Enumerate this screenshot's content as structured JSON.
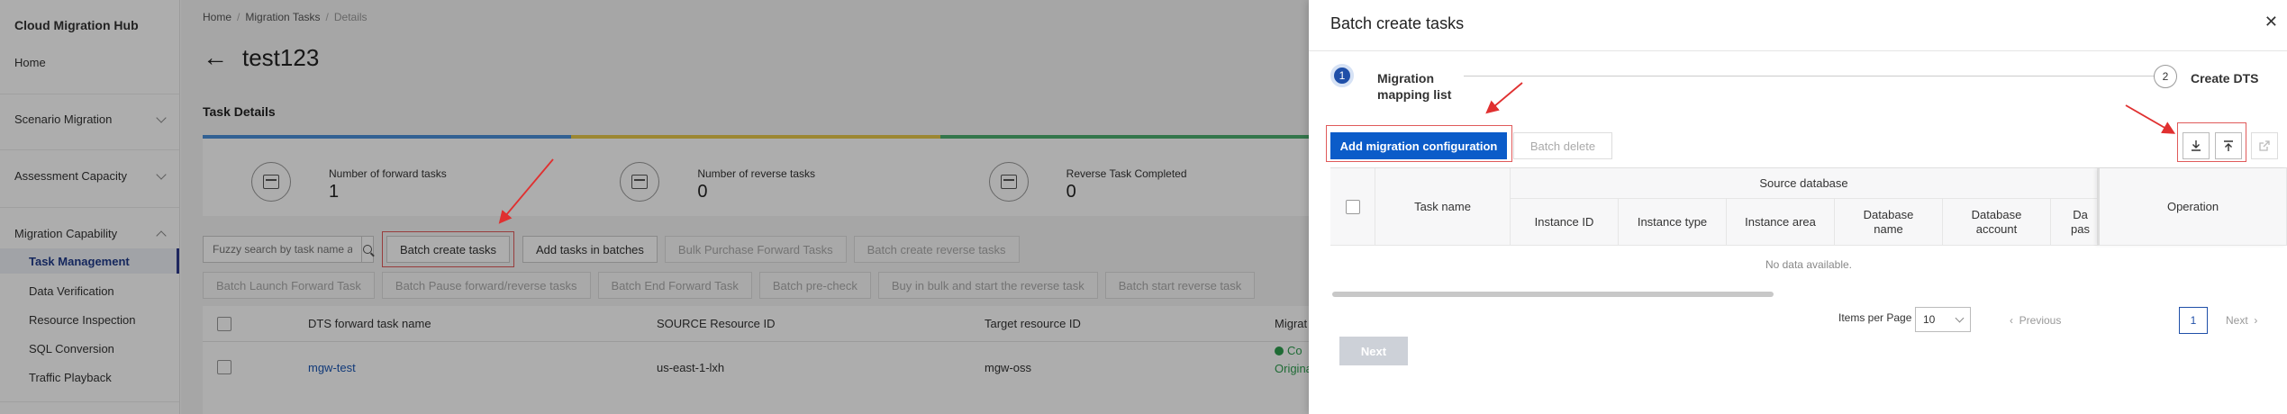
{
  "sidebar": {
    "title": "Cloud Migration Hub",
    "home": "Home",
    "scenario": "Scenario Migration",
    "assessment": "Assessment Capacity",
    "capability": "Migration Capability",
    "items": [
      "Task Management",
      "Data Verification",
      "Resource Inspection",
      "SQL Conversion",
      "Traffic Playback"
    ]
  },
  "breadcrumb": {
    "home": "Home",
    "tasks": "Migration Tasks",
    "current": "Details"
  },
  "page": {
    "title": "test123",
    "section_title": "Task Details"
  },
  "stats": [
    {
      "label": "Number of forward tasks",
      "value": "1"
    },
    {
      "label": "Number of reverse tasks",
      "value": "0"
    },
    {
      "label": "Reverse Task Completed",
      "value": "0"
    }
  ],
  "toolbar": {
    "search_placeholder": "Fuzzy search by task name a",
    "batch_create": "Batch create tasks",
    "add_batches": "Add tasks in batches",
    "bulk_purchase": "Bulk Purchase Forward Tasks",
    "batch_create_reverse": "Batch create reverse tasks",
    "batch_launch": "Batch Launch Forward Task",
    "batch_pause": "Batch Pause forward/reverse tasks",
    "batch_end": "Batch End Forward Task",
    "batch_precheck": "Batch pre-check",
    "buy_bulk": "Buy in bulk and start the reverse task",
    "batch_start_reverse": "Batch start reverse task"
  },
  "table": {
    "headers": [
      "DTS forward task name",
      "SOURCE Resource ID",
      "Target resource ID",
      "Migrat"
    ],
    "rows": [
      {
        "name": "mgw-test",
        "source": "us-east-1-lxh",
        "target": "mgw-oss",
        "status1": "Co",
        "status2": "Origina"
      }
    ]
  },
  "drawer": {
    "title": "Batch create tasks",
    "steps": [
      {
        "num": "1",
        "label_line1": "Migration",
        "label_line2": "mapping list"
      },
      {
        "num": "2",
        "label_line1": "Create DTS"
      }
    ],
    "add_config": "Add migration configuration",
    "batch_delete": "Batch delete",
    "table": {
      "task_name": "Task name",
      "source_database": "Source database",
      "instance_id": "Instance ID",
      "instance_type": "Instance type",
      "instance_area": "Instance area",
      "database_name": "Database name",
      "database_account": "Database account",
      "database_pass_partial": "Da pas",
      "operation": "Operation",
      "no_data": "No data available."
    },
    "pagination": {
      "items_per_page": "Items per Page",
      "page_size": "10",
      "previous": "Previous",
      "current": "1",
      "next": "Next"
    },
    "next_button": "Next"
  },
  "colors": {
    "primary": "#0b5cc9",
    "highlight": "#e05a5a",
    "success": "#2e9e4f"
  }
}
